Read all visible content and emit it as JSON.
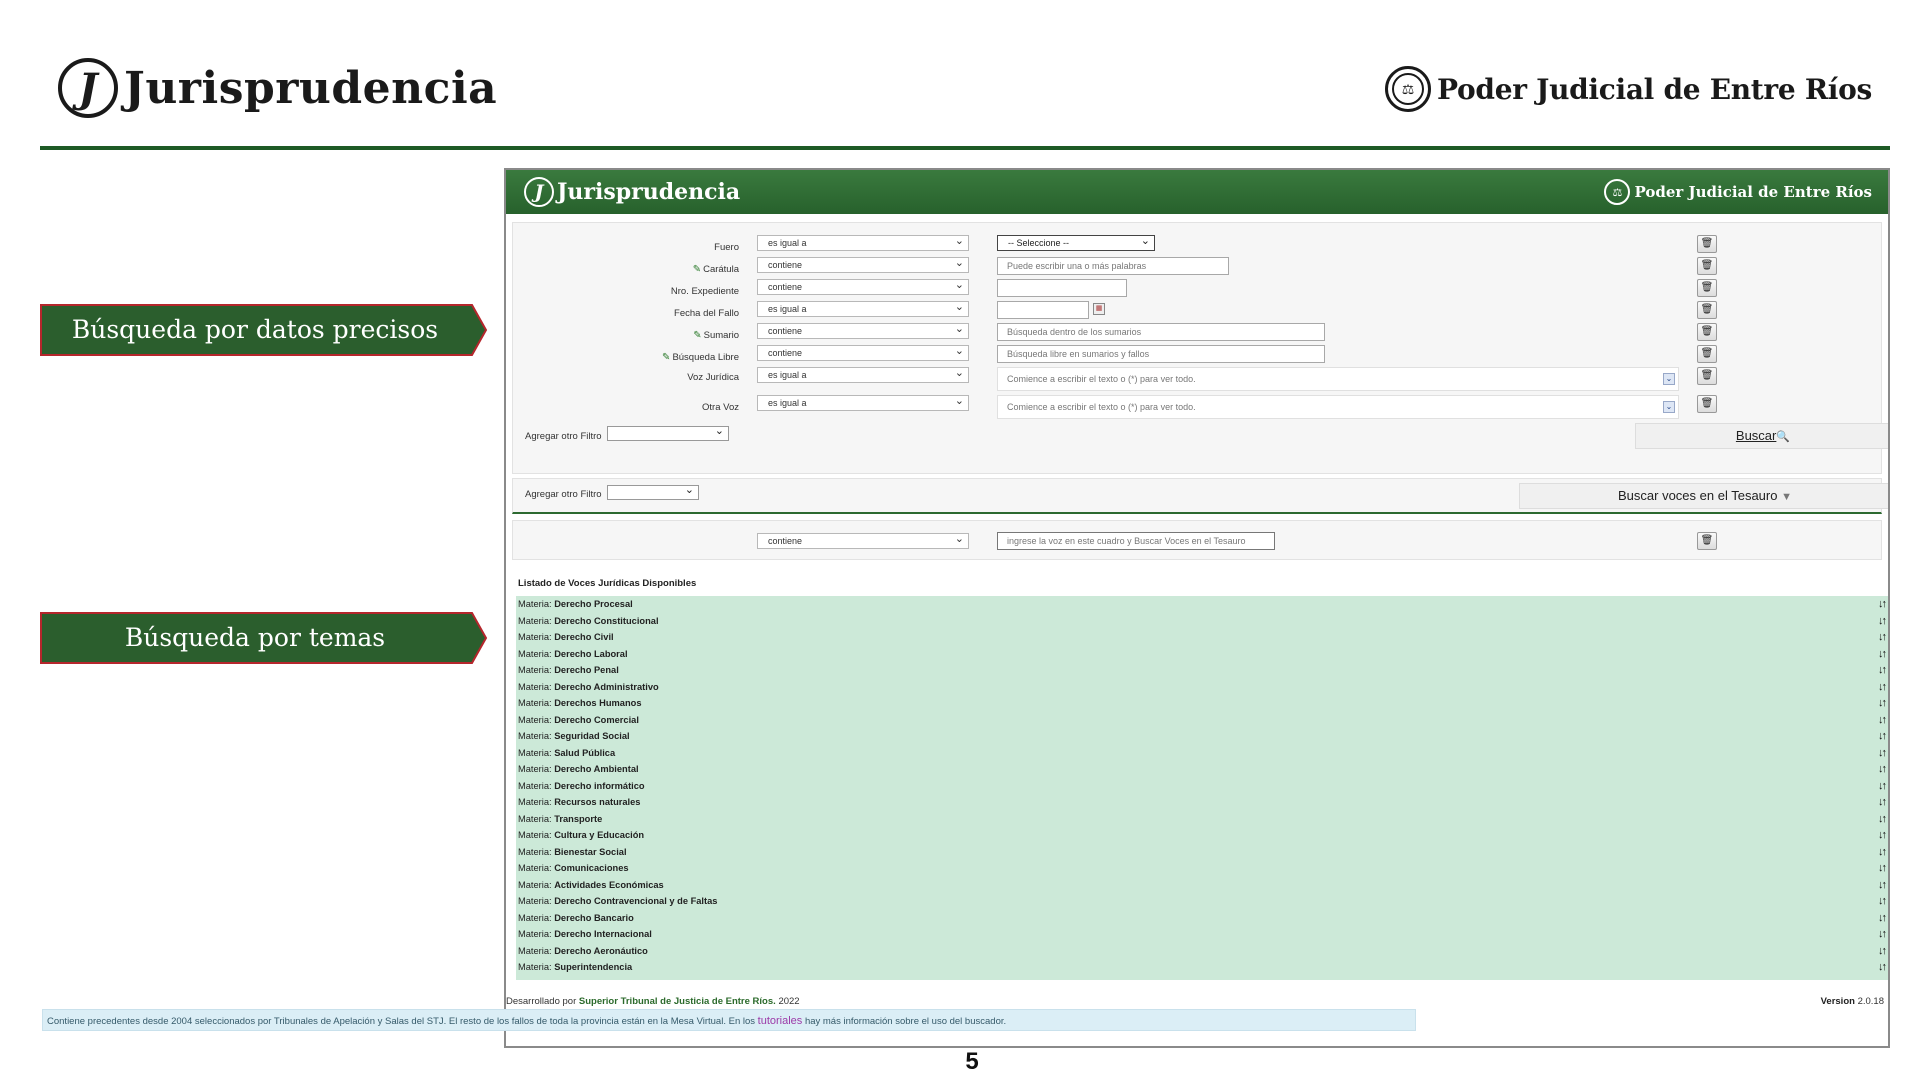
{
  "slide": {
    "logo_mark": "J",
    "logo_text": "Jurisprudencia",
    "org_text": "Poder Judicial de Entre Ríos",
    "label_precise": "Búsqueda por datos precisos",
    "label_topics": "Búsqueda por temas",
    "page_number": "5"
  },
  "app": {
    "logo_mark": "J",
    "logo_text": "Jurisprudencia",
    "org_text": "Poder Judicial de Entre Ríos",
    "filters": [
      {
        "label": "Fuero",
        "operator": "es igual a",
        "value": "-- Seleccione --"
      },
      {
        "label": "Carátula",
        "operator": "contiene",
        "placeholder": "Puede escribir una o más palabras"
      },
      {
        "label": "Nro. Expediente",
        "operator": "contiene",
        "placeholder": ""
      },
      {
        "label": "Fecha del Fallo",
        "operator": "es igual a",
        "placeholder": ""
      },
      {
        "label": "Sumario",
        "operator": "contiene",
        "placeholder": "Búsqueda dentro de los sumarios"
      },
      {
        "label": "Búsqueda Libre",
        "operator": "contiene",
        "placeholder": "Búsqueda libre en sumarios y fallos"
      },
      {
        "label": "Voz Jurídica",
        "operator": "es igual a",
        "placeholder": "Comience a escribir el texto o (*) para ver todo."
      },
      {
        "label": "Otra Voz",
        "operator": "es igual a",
        "placeholder": "Comience a escribir el texto o (*) para ver todo."
      }
    ],
    "add_filter_label": "Agregar otro Filtro",
    "search_button": "Buscar",
    "thesaurus_add_filter_label": "Agregar otro Filtro",
    "thesaurus_button": "Buscar voces en el Tesauro",
    "thesaurus_operator": "contiene",
    "thesaurus_placeholder": "ingrese la voz en este cuadro y Buscar Voces en el Tesauro",
    "list_title": "Listado de Voces Jurídicas Disponibles",
    "list_prefix": "Materia:",
    "list_items": [
      "Derecho Procesal",
      "Derecho Constitucional",
      "Derecho Civil",
      "Derecho Laboral",
      "Derecho Penal",
      "Derecho Administrativo",
      "Derechos Humanos",
      "Derecho Comercial",
      "Seguridad Social",
      "Salud Pública",
      "Derecho Ambiental",
      "Derecho informático",
      "Recursos naturales",
      "Transporte",
      "Cultura y Educación",
      "Bienestar Social",
      "Comunicaciones",
      "Actividades Económicas",
      "Derecho Contravencional y de Faltas",
      "Derecho Bancario",
      "Derecho Internacional",
      "Derecho Aeronáutico",
      "Superintendencia"
    ],
    "footer_dev_prefix": "Desarrollado por",
    "footer_dev_org": "Superior Tribunal de Justicia de Entre Ríos.",
    "footer_dev_year": "2022",
    "footer_version_label": "Version",
    "footer_version": "2.0.18",
    "note_text": "Contiene precedentes desde 2004 seleccionados por Tribunales de Apelación y Salas del STJ. El resto de los fallos de toda la provincia están en la Mesa Virtual. En los",
    "note_link": "tutoriales",
    "note_suffix": "hay más información sobre el uso del buscador."
  },
  "colors": {
    "brand_green": "#1e5a25",
    "list_bg": "#cce9d8",
    "arrow_fill": "#2b5e2d",
    "arrow_border": "#b5262c"
  }
}
